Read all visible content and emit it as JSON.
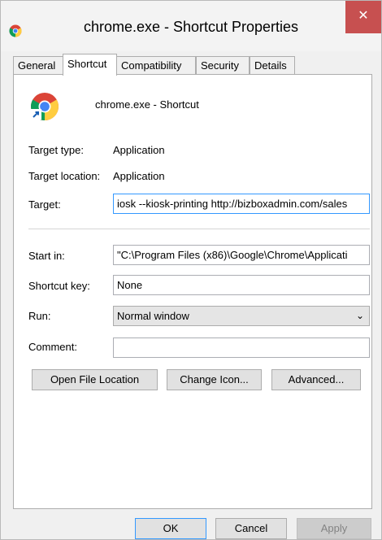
{
  "window": {
    "title": "chrome.exe - Shortcut Properties",
    "close_glyph": "✕"
  },
  "tabs": [
    {
      "label": "General"
    },
    {
      "label": "Shortcut"
    },
    {
      "label": "Compatibility"
    },
    {
      "label": "Security"
    },
    {
      "label": "Details"
    }
  ],
  "header": {
    "icon": "chrome-icon",
    "name": "chrome.exe - Shortcut"
  },
  "info": {
    "target_type_label": "Target type:",
    "target_type_value": "Application",
    "target_location_label": "Target location:",
    "target_location_value": "Application"
  },
  "form": {
    "target_label": "Target:",
    "target_value": "iosk --kiosk-printing http://bizboxadmin.com/sales",
    "start_in_label": "Start in:",
    "start_in_value": "\"C:\\Program Files (x86)\\Google\\Chrome\\Applicati",
    "shortcut_key_label": "Shortcut key:",
    "shortcut_key_value": "None",
    "run_label": "Run:",
    "run_value": "Normal window",
    "comment_label": "Comment:",
    "comment_value": ""
  },
  "actions": {
    "open_file_location": "Open File Location",
    "change_icon": "Change Icon...",
    "advanced": "Advanced..."
  },
  "footer": {
    "ok": "OK",
    "cancel": "Cancel",
    "apply": "Apply"
  },
  "colors": {
    "close_button": "#c75050",
    "focus_border": "#3399ff"
  }
}
